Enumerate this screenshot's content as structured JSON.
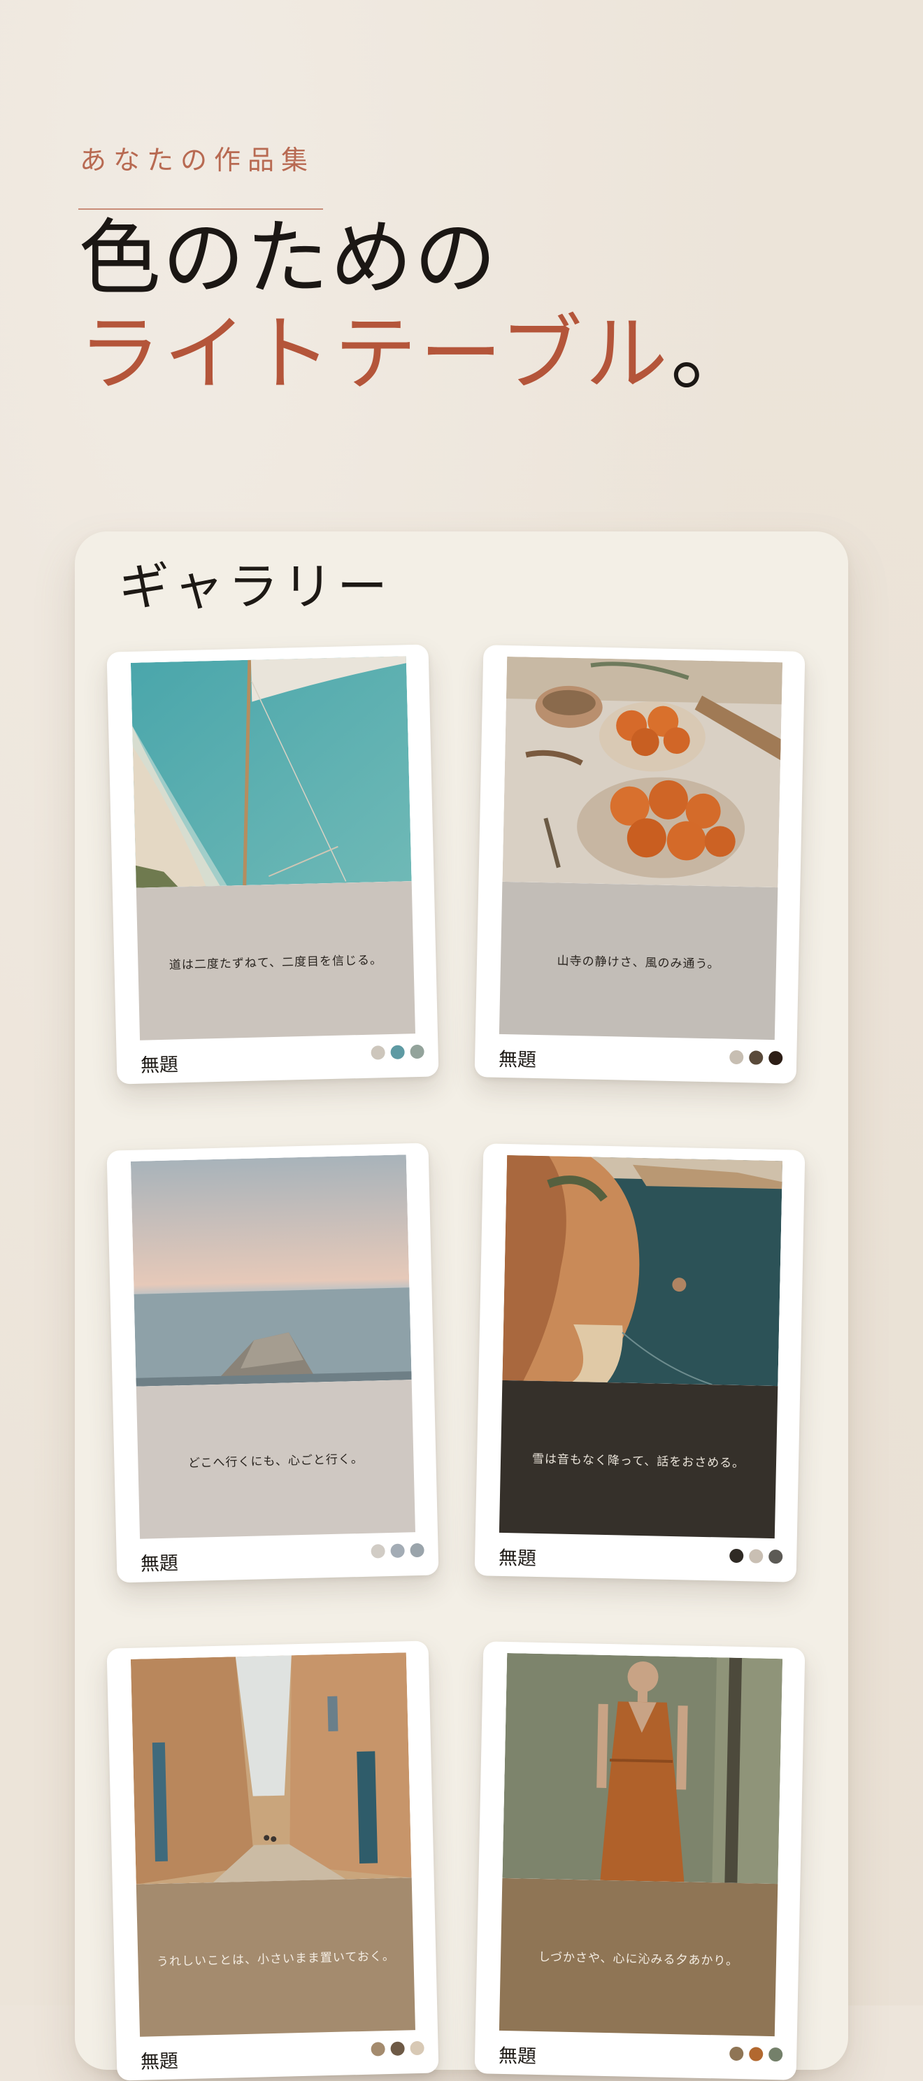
{
  "header": {
    "eyebrow": "あなたの作品集",
    "headline_line1": "色のための",
    "headline_line2": "ライトテーブル",
    "headline_period": "。"
  },
  "gallery": {
    "title": "ギャラリー",
    "cards": [
      {
        "quote": "道は二度たずねて、二度目を信じる。",
        "name": "無題",
        "swatch_color": "#cbc4bd",
        "quote_color": "#2a2520",
        "palette": [
          "#cdc6bc",
          "#5e9aa3",
          "#93a39b"
        ]
      },
      {
        "quote": "山寺の静けさ、風のみ通う。",
        "name": "無題",
        "swatch_color": "#c2bdb7",
        "quote_color": "#2a2520",
        "palette": [
          "#c7beb2",
          "#5a4a3a",
          "#2d1e16"
        ]
      },
      {
        "quote": "どこへ行くにも、心ごと行く。",
        "name": "無題",
        "swatch_color": "#cfc8c2",
        "quote_color": "#2a2520",
        "palette": [
          "#d1ccc5",
          "#a3acb5",
          "#9aa4ab"
        ]
      },
      {
        "quote": "雪は音もなく降って、話をおさめる。",
        "name": "無題",
        "swatch_color": "#35302a",
        "quote_color": "#e8e2d8",
        "palette": [
          "#2f2a24",
          "#c9bfb3",
          "#5c5a55"
        ]
      },
      {
        "quote": "うれしいことは、小さいまま置いておく。",
        "name": "無題",
        "swatch_color": "#a48b6e",
        "quote_color": "#f4ede3",
        "palette": [
          "#a48b6e",
          "#6e5a46",
          "#d8c9b5"
        ]
      },
      {
        "quote": "しづかさや、心に沁みる夕あかり。",
        "name": "無題",
        "swatch_color": "#8f7555",
        "quote_color": "#f4ede3",
        "palette": [
          "#8f7555",
          "#b2682f",
          "#74806a"
        ]
      }
    ]
  }
}
